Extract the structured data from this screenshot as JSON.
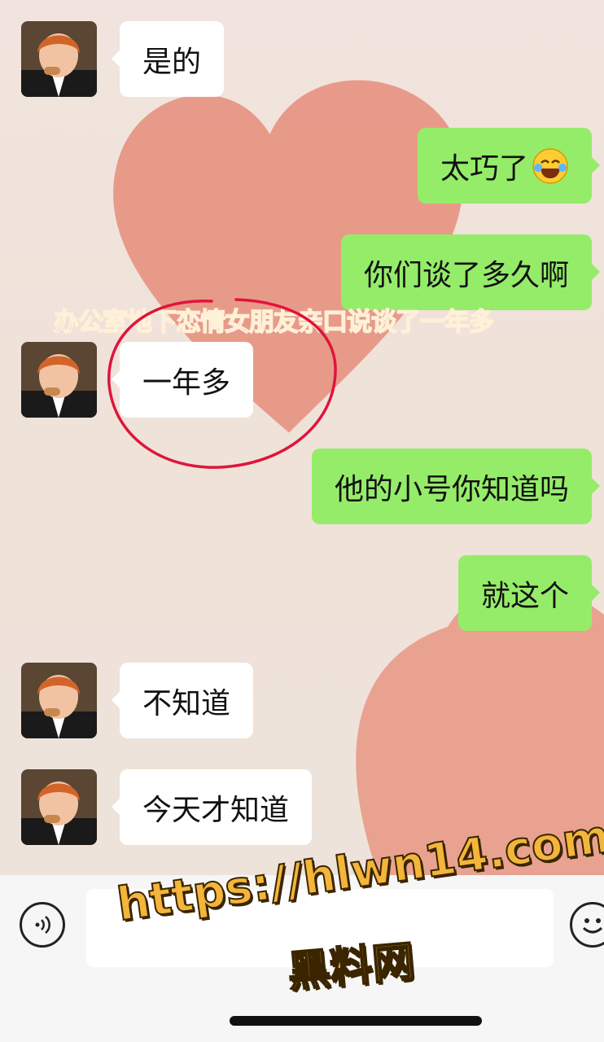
{
  "messages": [
    {
      "id": "m1",
      "side": "in",
      "text": "是的"
    },
    {
      "id": "m2",
      "side": "out",
      "text": "太巧了",
      "emoji": "😂"
    },
    {
      "id": "m3",
      "side": "out",
      "text": "你们谈了多久啊"
    },
    {
      "id": "m4",
      "side": "in",
      "text": "一年多"
    },
    {
      "id": "m5",
      "side": "out",
      "text": "他的小号你知道吗"
    },
    {
      "id": "m6",
      "side": "out",
      "text": "就这个"
    },
    {
      "id": "m7",
      "side": "in",
      "text": "不知道"
    },
    {
      "id": "m8",
      "side": "in",
      "text": "今天才知道"
    }
  ],
  "caption": "办公室地下恋情女朋友亲口说谈了一年多",
  "watermark": {
    "url": "https://hlwn14.com",
    "name": "黑料网"
  },
  "input": {
    "placeholder": ""
  },
  "icons": {
    "voice": "voice-icon",
    "emoji": "emoji-icon"
  },
  "colors": {
    "incoming_bubble": "#ffffff",
    "outgoing_bubble": "#95ec69",
    "annotation": "#e0143c",
    "watermark": "#f3b53a"
  }
}
